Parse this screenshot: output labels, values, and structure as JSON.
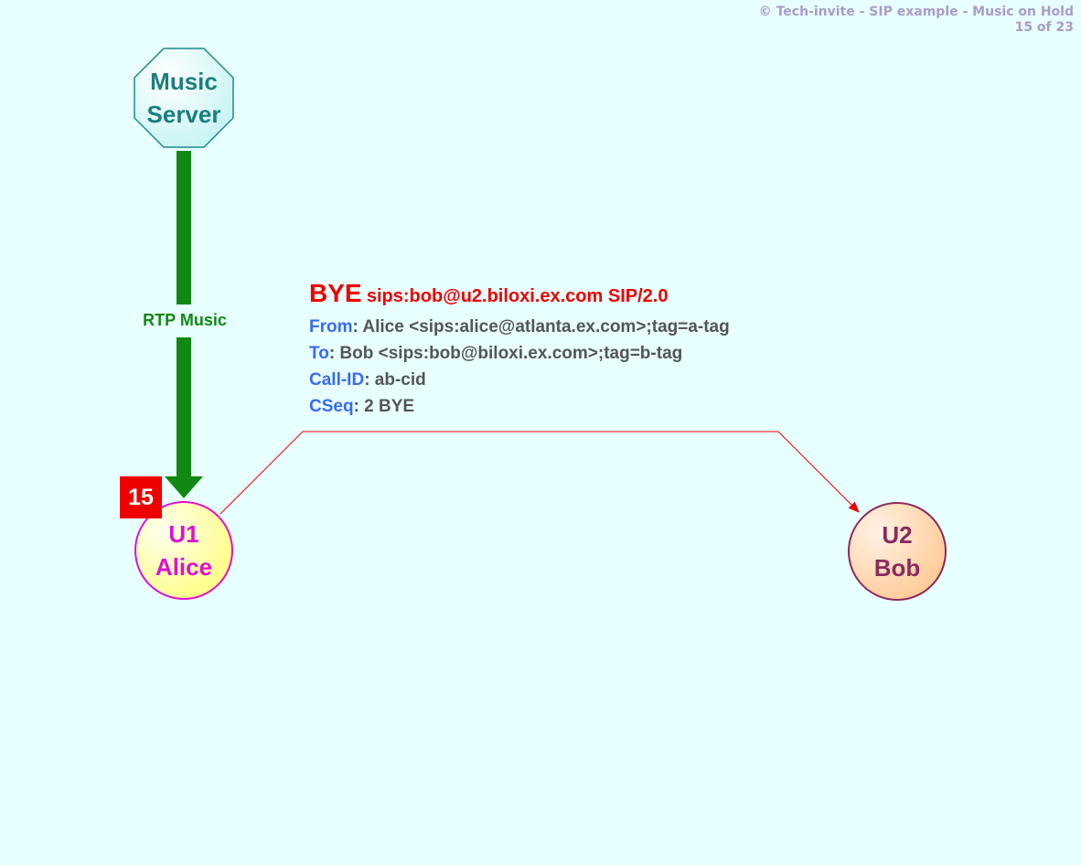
{
  "header": {
    "copyright": "© Tech-invite - SIP example - Music on Hold",
    "page_indicator": "15 of 23"
  },
  "nodes": {
    "music_server": {
      "line1": "Music",
      "line2": "Server",
      "color": "#1a7f7f"
    },
    "alice": {
      "line1": "U1",
      "line2": "Alice",
      "color": "#e010d0"
    },
    "bob": {
      "line1": "U2",
      "line2": "Bob",
      "color": "#8b2a5e"
    }
  },
  "media_flow": {
    "label": "RTP Music",
    "color": "#118811"
  },
  "step": {
    "number": "15"
  },
  "message": {
    "method": "BYE",
    "request_uri": "sips:bob@u2.biloxi.ex.com SIP/2.0",
    "headers": [
      {
        "name": "From",
        "value": ": Alice <sips:alice@atlanta.ex.com>;tag=a-tag"
      },
      {
        "name": "To",
        "value": ": Bob <sips:bob@biloxi.ex.com>;tag=b-tag"
      },
      {
        "name": "Call-ID",
        "value": ": ab-cid"
      },
      {
        "name": "CSeq",
        "value": ": 2 BYE"
      }
    ],
    "arrow_color": "#ee0000"
  }
}
